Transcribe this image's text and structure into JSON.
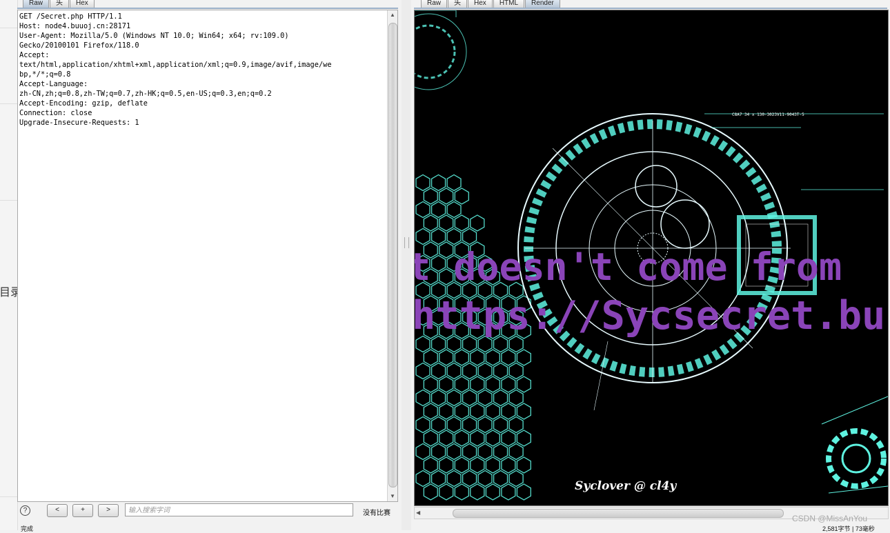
{
  "sidebar": {
    "toc_label": "目录"
  },
  "request_panel": {
    "tabs": [
      {
        "label": "Raw",
        "active": true
      },
      {
        "label": "头",
        "active": false
      },
      {
        "label": "Hex",
        "active": false
      }
    ],
    "lines": [
      "GET /Secret.php HTTP/1.1",
      "Host: node4.buuoj.cn:28171",
      "User-Agent: Mozilla/5.0 (Windows NT 10.0; Win64; x64; rv:109.0)",
      "Gecko/20100101 Firefox/118.0",
      "Accept:",
      "text/html,application/xhtml+xml,application/xml;q=0.9,image/avif,image/we",
      "bp,*/*;q=0.8",
      "Accept-Language:",
      "zh-CN,zh;q=0.8,zh-TW;q=0.7,zh-HK;q=0.5,en-US;q=0.3,en;q=0.2",
      "Accept-Encoding: gzip, deflate",
      "Connection: close",
      "Upgrade-Insecure-Requests: 1"
    ],
    "search": {
      "help_label": "?",
      "prev_label": "<",
      "add_label": "+",
      "next_label": ">",
      "placeholder": "输入搜索字词",
      "match_status": "没有比赛"
    },
    "status_text": "完成"
  },
  "response_panel": {
    "tabs": [
      {
        "label": "Raw",
        "active": false
      },
      {
        "label": "头",
        "active": false
      },
      {
        "label": "Hex",
        "active": false
      },
      {
        "label": "HTML",
        "active": false
      },
      {
        "label": "Render",
        "active": true
      }
    ],
    "render": {
      "line1": "t doesn't come from",
      "line2": "https://Sycsecret.buuo",
      "signature": "Syclover @ cl4y",
      "hud_text": "C8A7    34 x    130-3023V11-9043T-5"
    },
    "status_text": "2,581字节 | 73毫秒"
  },
  "watermark": "CSDN @MissAnYou",
  "colors": {
    "render_bg": "#000000",
    "headline": "#8a44b8",
    "hud_cyan": "#5ef2e0",
    "active_tab": "#b9c7d6"
  }
}
